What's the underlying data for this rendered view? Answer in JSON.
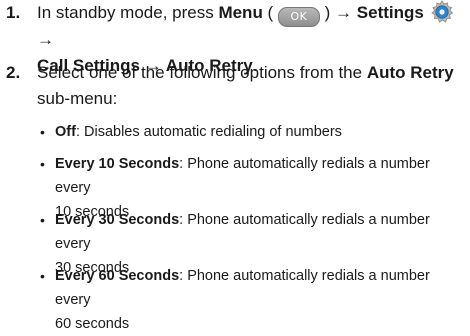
{
  "steps": [
    {
      "number": "1.",
      "text_before": "In standby mode, press ",
      "menu": "Menu",
      "open_paren": " ( ",
      "ok_key": "OK",
      "close_paren": " ) ",
      "arrow1": "→ ",
      "settings": "Settings",
      "arrow2": " → ",
      "call_settings": "Call Settings",
      "arrow3": " → ",
      "auto_retry": "Auto Retry",
      "period": "."
    },
    {
      "number": "2.",
      "text_before": "Select one of the following options from the ",
      "menu_name": "Auto Retry",
      "text_after": "sub-menu:"
    }
  ],
  "options": [
    {
      "term": "Off",
      "desc": ": Disables automatic redialing of numbers"
    },
    {
      "term": "Every 10 Seconds",
      "desc": ": Phone automatically redials a number every",
      "desc2": "10 seconds"
    },
    {
      "term": "Every 30 Seconds",
      "desc": ": Phone automatically redials a number every",
      "desc2": "30 seconds"
    },
    {
      "term": "Every 60 Seconds",
      "desc": ": Phone automatically redials a number every",
      "desc2": "60 seconds"
    }
  ],
  "icons": {
    "ok_key": "ok-key-icon",
    "settings": "settings-gear-icon"
  },
  "colors": {
    "text": "#1a1a1a",
    "ok_key": "#9a9a9a",
    "settings_icon": "#2e86c8"
  }
}
